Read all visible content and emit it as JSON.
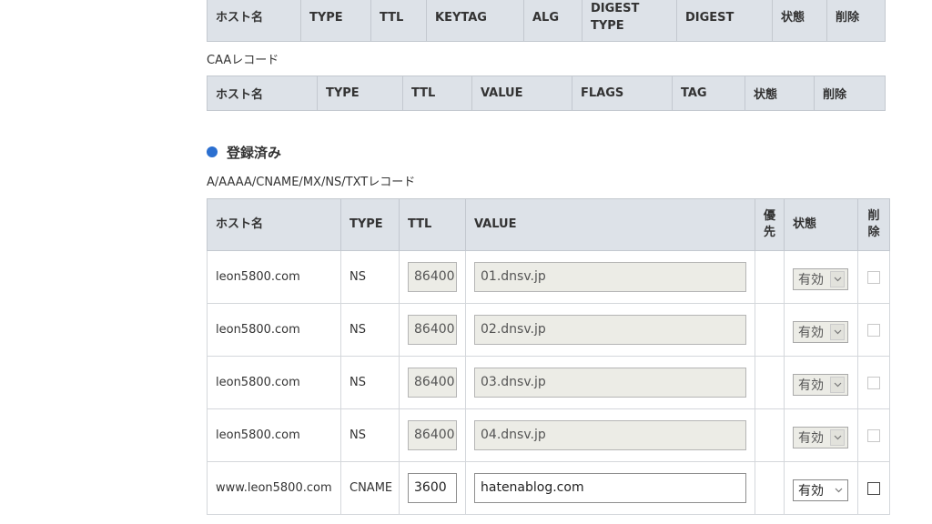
{
  "ds_table": {
    "headers": [
      "ホスト名",
      "TYPE",
      "TTL",
      "KEYTAG",
      "ALG",
      "DIGEST TYPE",
      "DIGEST",
      "状態",
      "削除"
    ]
  },
  "caa_section": {
    "caption": "CAAレコード",
    "headers": [
      "ホスト名",
      "TYPE",
      "TTL",
      "VALUE",
      "FLAGS",
      "TAG",
      "状態",
      "削除"
    ]
  },
  "registered": {
    "title": "登録済み",
    "caption": "A/AAAA/CNAME/MX/NS/TXTレコード",
    "headers": {
      "host": "ホスト名",
      "type": "TYPE",
      "ttl": "TTL",
      "value": "VALUE",
      "priority": "優先",
      "status": "状態",
      "delete": "削除"
    },
    "rows": [
      {
        "host": "leon5800.com",
        "type": "NS",
        "ttl": "86400",
        "value": "01.dnsv.jp",
        "status": "有効",
        "editable": false
      },
      {
        "host": "leon5800.com",
        "type": "NS",
        "ttl": "86400",
        "value": "02.dnsv.jp",
        "status": "有効",
        "editable": false
      },
      {
        "host": "leon5800.com",
        "type": "NS",
        "ttl": "86400",
        "value": "03.dnsv.jp",
        "status": "有効",
        "editable": false
      },
      {
        "host": "leon5800.com",
        "type": "NS",
        "ttl": "86400",
        "value": "04.dnsv.jp",
        "status": "有効",
        "editable": false
      },
      {
        "host": "www.leon5800.com",
        "type": "CNAME",
        "ttl": "3600",
        "value": "hatenablog.com",
        "status": "有効",
        "editable": true
      }
    ]
  },
  "colors": {
    "header_bg": "#dde2e8",
    "bullet": "#2b6fd0",
    "disabled_field_bg": "#ecece6"
  },
  "icons": {
    "bullet": "blue-dot-icon",
    "select_arrow": "chevron-down-icon"
  }
}
